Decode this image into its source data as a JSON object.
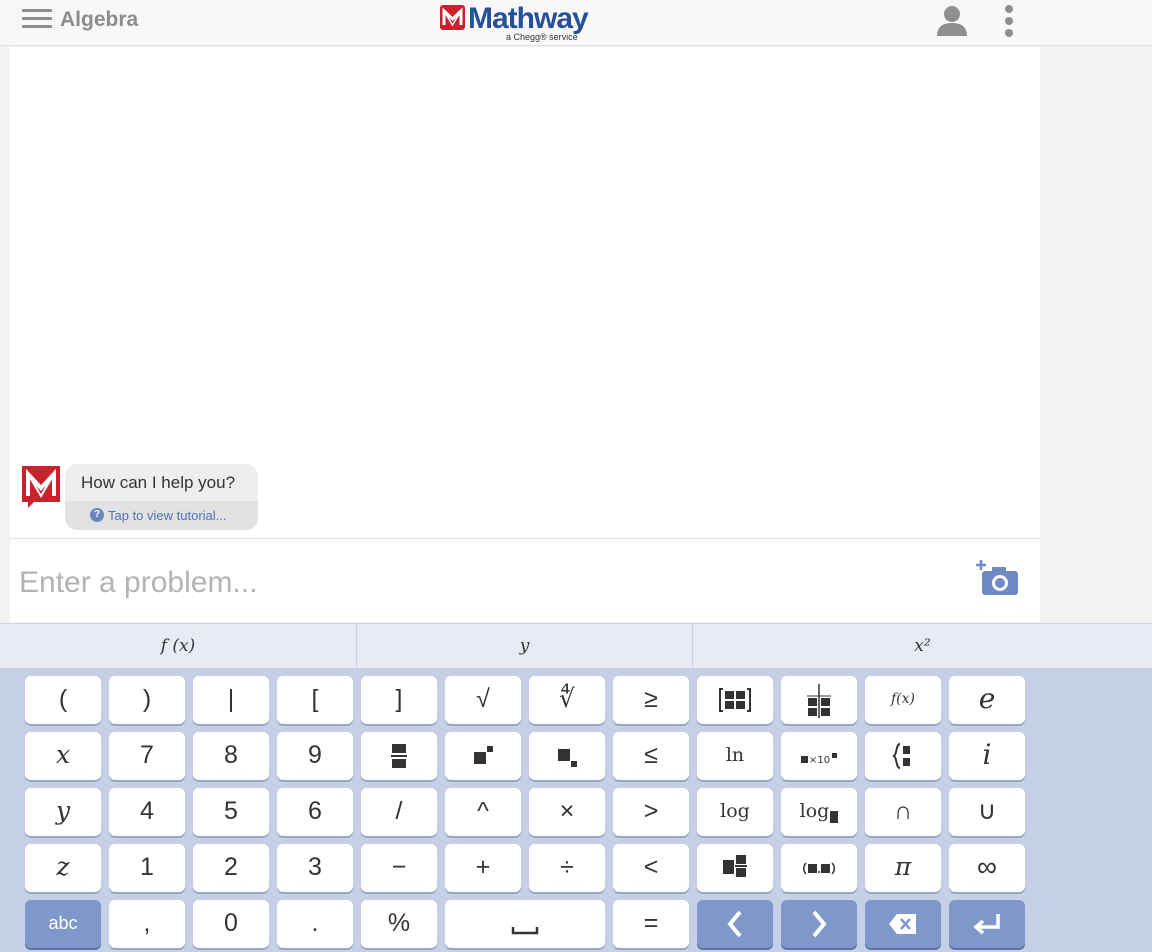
{
  "header": {
    "subject": "Algebra",
    "logo_word": "Mathway",
    "logo_sub": "a Chegg® service"
  },
  "chat": {
    "greeting": "How can I help you?",
    "tutorial_link": "Tap to view tutorial...",
    "help_icon_glyph": "?"
  },
  "input": {
    "placeholder": "Enter a problem..."
  },
  "tabs": [
    {
      "label": "f (x)"
    },
    {
      "label": "y"
    },
    {
      "label": "x²"
    }
  ],
  "keypad": {
    "row1": [
      "(",
      ")",
      "|",
      "[",
      "]",
      "√",
      "∜",
      "≥",
      "matrix-icon",
      "table-icon",
      "f(x)",
      "e"
    ],
    "row2": [
      "x",
      "7",
      "8",
      "9",
      "fraction-icon",
      "superscript-icon",
      "subscript-icon",
      "≤",
      "ln",
      "scientific-notation-icon",
      "piecewise-icon",
      "i"
    ],
    "row3": [
      "y",
      "4",
      "5",
      "6",
      "/",
      "^",
      "×",
      ">",
      "log",
      "log-base-icon",
      "∩",
      "∪"
    ],
    "row4": [
      "z",
      "1",
      "2",
      "3",
      "−",
      "+",
      "÷",
      "<",
      "mixed-number-icon",
      "interval-icon",
      "π",
      "∞"
    ],
    "row5": [
      "abc",
      ",",
      "0",
      ".",
      "%",
      "space-icon",
      "=",
      "left-arrow-icon",
      "right-arrow-icon",
      "backspace-icon",
      "enter-icon"
    ],
    "labels": {
      "lparen": "(",
      "rparen": ")",
      "pipe": "|",
      "lbrack": "[",
      "rbrack": "]",
      "sqrt": "√",
      "nthroot": "∜",
      "geq": "≥",
      "fx": "f(x)",
      "e": "e",
      "x": "x",
      "seven": "7",
      "eight": "8",
      "nine": "9",
      "leq": "≤",
      "ln": "ln",
      "sci": "×10",
      "i": "i",
      "y": "y",
      "four": "4",
      "five": "5",
      "six": "6",
      "slash": "/",
      "caret": "^",
      "times": "×",
      "gt": ">",
      "log": "log",
      "logb": "log",
      "cap": "∩",
      "cup": "∪",
      "z": "z",
      "one": "1",
      "two": "2",
      "three": "3",
      "minus": "−",
      "plus": "+",
      "divide": "÷",
      "lt": "<",
      "pi": "π",
      "inf": "∞",
      "abc": "abc",
      "comma": ",",
      "zero": "0",
      "dot": ".",
      "percent": "%",
      "equals": "="
    }
  },
  "colors": {
    "brand_red": "#c8232c",
    "brand_blue": "#26509b",
    "keypad_bg": "#c5cfe5",
    "action_key": "#7f98cb"
  }
}
